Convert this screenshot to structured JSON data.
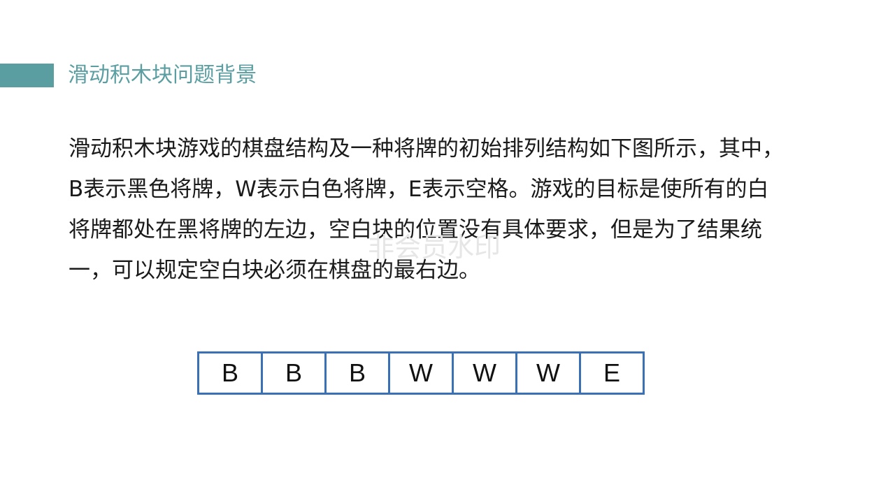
{
  "title": "滑动积木块问题背景",
  "paragraph": {
    "lines": [
      "滑动积木块游戏的棋盘结构及一种将牌的初始排列结构如下图所示，其中，",
      "B表示黑色将牌，W表示白色将牌，E表示空格。游戏的目标是使所有的白",
      "将牌都处在黑将牌的左边，空白块的位置没有具体要求，但是为了结果统",
      "一，可以规定空白块必须在棋盘的最右边。"
    ]
  },
  "board": {
    "cells": [
      "B",
      "B",
      "B",
      "W",
      "W",
      "W",
      "E"
    ]
  },
  "watermark": "非会员水印",
  "colors": {
    "accent": "#5a9ea1",
    "board_border": "#3a70b5",
    "text": "#1a1a1a"
  }
}
